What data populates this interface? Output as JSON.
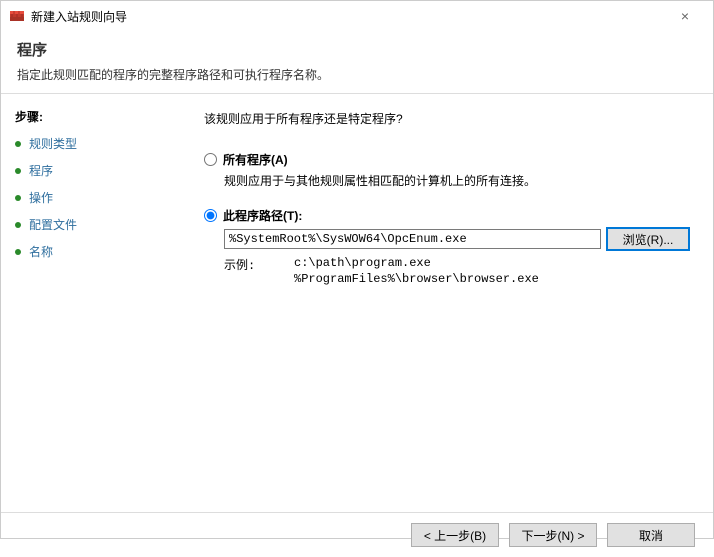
{
  "window": {
    "title": "新建入站规则向导",
    "close": "×"
  },
  "header": {
    "title": "程序",
    "subtitle": "指定此规则匹配的程序的完整程序路径和可执行程序名称。"
  },
  "sidebar": {
    "steps_label": "步骤:",
    "items": [
      {
        "label": "规则类型"
      },
      {
        "label": "程序"
      },
      {
        "label": "操作"
      },
      {
        "label": "配置文件"
      },
      {
        "label": "名称"
      }
    ]
  },
  "content": {
    "question": "该规则应用于所有程序还是特定程序?",
    "option_all": {
      "label": "所有程序(A)",
      "desc": "规则应用于与其他规则属性相匹配的计算机上的所有连接。"
    },
    "option_path": {
      "label": "此程序路径(T):",
      "value": "%SystemRoot%\\SysWOW64\\OpcEnum.exe",
      "browse": "浏览(R)..."
    },
    "example": {
      "label": "示例:",
      "values": "c:\\path\\program.exe\n%ProgramFiles%\\browser\\browser.exe"
    }
  },
  "footer": {
    "back": "< 上一步(B)",
    "next": "下一步(N) >",
    "cancel": "取消"
  }
}
